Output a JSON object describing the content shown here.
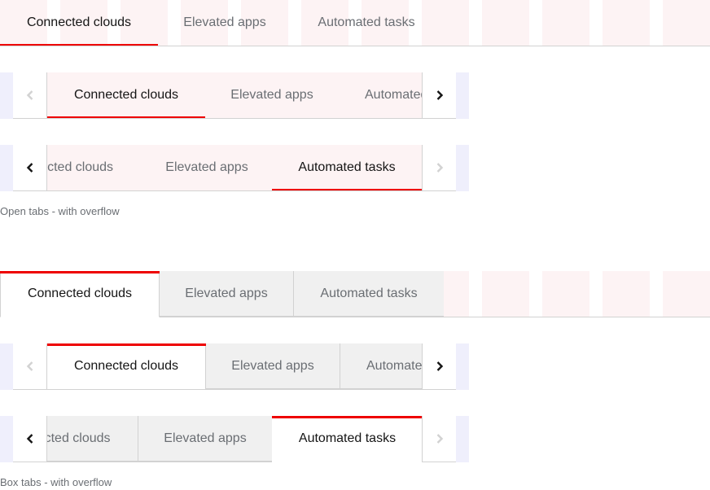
{
  "tabs": {
    "labels": [
      "Connected clouds",
      "Elevated apps",
      "Automated tasks"
    ],
    "truncated_label_start": "Automate",
    "truncated_label_end": "cted clouds"
  },
  "open_tabs": {
    "full_row": {
      "active_index": 0
    },
    "scroll_row_start": {
      "active_index": 0,
      "scroll_left_enabled": false,
      "scroll_right_enabled": true
    },
    "scroll_row_end": {
      "active_index": 2,
      "scroll_left_enabled": true,
      "scroll_right_enabled": false
    },
    "caption": "Open tabs - with overflow"
  },
  "box_tabs": {
    "full_row": {
      "active_index": 0
    },
    "scroll_row_start": {
      "active_index": 0,
      "scroll_left_enabled": false,
      "scroll_right_enabled": true
    },
    "scroll_row_end": {
      "active_index": 2,
      "scroll_left_enabled": true,
      "scroll_right_enabled": false
    },
    "caption": "Box tabs - with overflow"
  },
  "icons": {
    "scroll_left": "chevron-left-icon",
    "scroll_right": "chevron-right-icon"
  },
  "colors": {
    "accent": "#ee0000",
    "active_text": "#151515",
    "inactive_text": "#6a6e73",
    "border": "#d2d2d2",
    "box_tab_bg": "#f0f0f0",
    "grid_overlay": "#fdf3f4",
    "gutter_overlay": "#efeffc",
    "disabled_icon": "#d2d2d2"
  }
}
